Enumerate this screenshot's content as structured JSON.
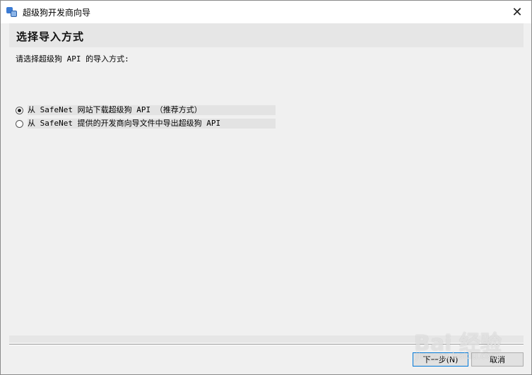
{
  "window": {
    "title": "超级狗开发商向导",
    "close_glyph": "✕"
  },
  "header": {
    "title": "选择导入方式"
  },
  "content": {
    "prompt": "请选择超级狗 API 的导入方式:",
    "options": [
      {
        "label": "从 SafeNet 网站下载超级狗 API （推荐方式）",
        "selected": true
      },
      {
        "label": "从 SafeNet 提供的开发商向导文件中导出超级狗 API",
        "selected": false
      }
    ]
  },
  "buttons": {
    "next_label": "下一步(N)",
    "cancel_label": "取消"
  },
  "watermark": {
    "text": "Bai 经验",
    "sub": "jingyan.baidu.com"
  }
}
